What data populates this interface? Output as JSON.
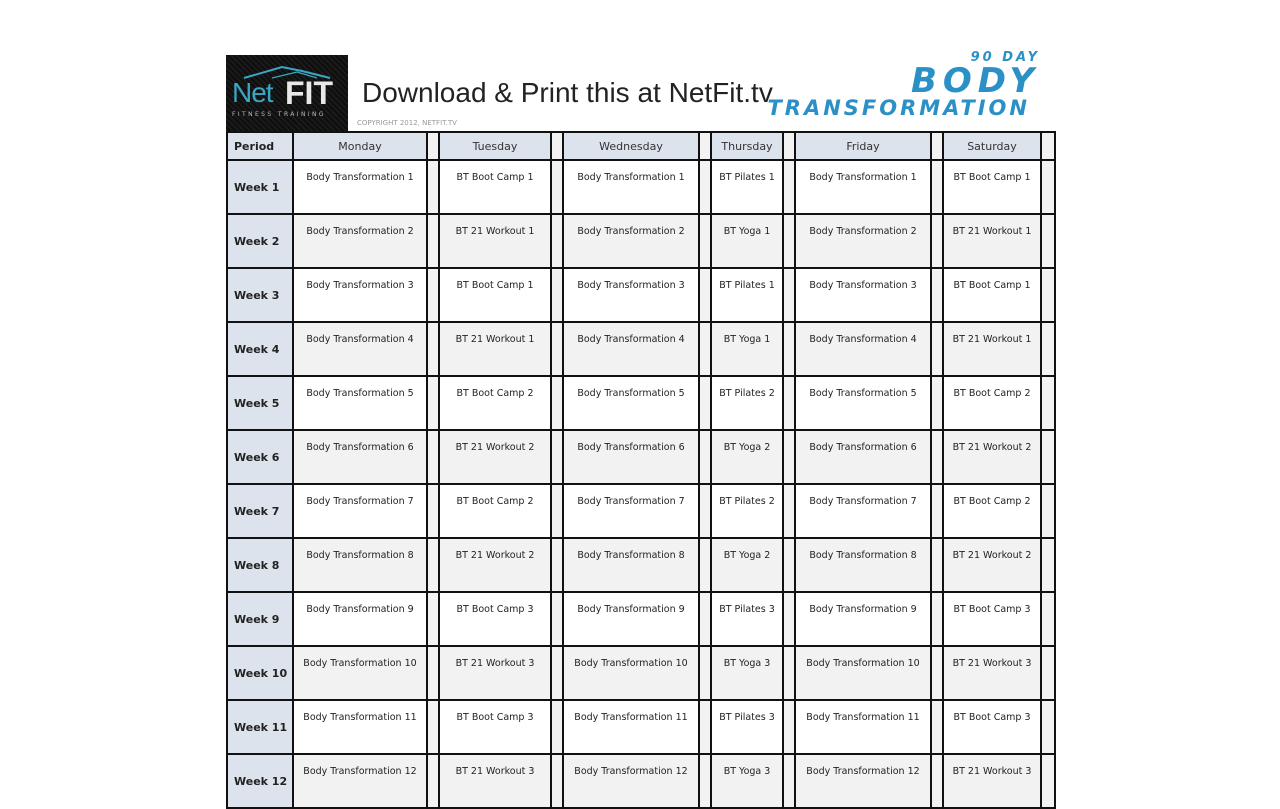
{
  "header": {
    "logo": {
      "net": "Net",
      "fit": "FIT",
      "tagline": "FITNESS TRAINING"
    },
    "title": "Download & Print this at NetFit.tv",
    "copyright": "COPYRIGHT 2012, NETFIT.TV",
    "brand": {
      "line1": "90 DAY",
      "line2": "BODY",
      "line3": "TRANSFORMATION"
    }
  },
  "colors": {
    "header_fill": "#dde3ec",
    "brand_blue": "#2b90c6",
    "logo_teal": "#3aa6c4"
  },
  "table": {
    "columns": [
      "Period",
      "Monday",
      "Tuesday",
      "Wednesday",
      "Thursday",
      "Friday",
      "Saturday"
    ],
    "rows": [
      {
        "period": "Week 1",
        "cells": [
          "Body Transformation  1",
          "BT Boot Camp 1",
          "Body Transformation  1",
          "BT Pilates 1",
          "Body Transformation  1",
          "BT Boot Camp 1"
        ]
      },
      {
        "period": "Week 2",
        "cells": [
          "Body Transformation  2",
          "BT 21 Workout 1",
          "Body Transformation  2",
          "BT Yoga 1",
          "Body Transformation  2",
          "BT 21 Workout 1"
        ]
      },
      {
        "period": "Week 3",
        "cells": [
          "Body Transformation  3",
          "BT Boot Camp 1",
          "Body Transformation  3",
          "BT Pilates 1",
          "Body Transformation  3",
          "BT Boot Camp 1"
        ]
      },
      {
        "period": "Week 4",
        "cells": [
          "Body Transformation  4",
          "BT 21 Workout 1",
          "Body Transformation  4",
          "BT Yoga 1",
          "Body Transformation  4",
          "BT 21 Workout 1"
        ]
      },
      {
        "period": "Week 5",
        "cells": [
          "Body Transformation  5",
          "BT Boot Camp 2",
          "Body Transformation  5",
          "BT Pilates 2",
          "Body Transformation  5",
          "BT Boot Camp 2"
        ]
      },
      {
        "period": "Week 6",
        "cells": [
          "Body Transformation  6",
          "BT 21 Workout 2",
          "Body Transformation  6",
          "BT Yoga 2",
          "Body Transformation  6",
          "BT 21 Workout 2"
        ]
      },
      {
        "period": "Week 7",
        "cells": [
          "Body Transformation  7",
          "BT Boot Camp 2",
          "Body Transformation  7",
          "BT Pilates 2",
          "Body Transformation  7",
          "BT Boot Camp 2"
        ]
      },
      {
        "period": "Week 8",
        "cells": [
          "Body Transformation  8",
          "BT 21 Workout 2",
          "Body Transformation  8",
          "BT Yoga 2",
          "Body Transformation  8",
          "BT 21 Workout 2"
        ]
      },
      {
        "period": "Week 9",
        "cells": [
          "Body Transformation  9",
          "BT Boot Camp 3",
          "Body Transformation  9",
          "BT Pilates 3",
          "Body Transformation  9",
          "BT Boot Camp 3"
        ]
      },
      {
        "period": "Week 10",
        "cells": [
          "Body Transformation  10",
          "BT 21 Workout 3",
          "Body Transformation  10",
          "BT Yoga 3",
          "Body Transformation  10",
          "BT 21 Workout 3"
        ]
      },
      {
        "period": "Week 11",
        "cells": [
          "Body Transformation  11",
          "BT Boot Camp 3",
          "Body Transformation  11",
          "BT Pilates 3",
          "Body Transformation  11",
          "BT Boot Camp 3"
        ]
      },
      {
        "period": "Week 12",
        "cells": [
          "Body Transformation  12",
          "BT 21 Workout 3",
          "Body Transformation  12",
          "BT Yoga 3",
          "Body Transformation  12",
          "BT 21 Workout 3"
        ]
      }
    ]
  }
}
